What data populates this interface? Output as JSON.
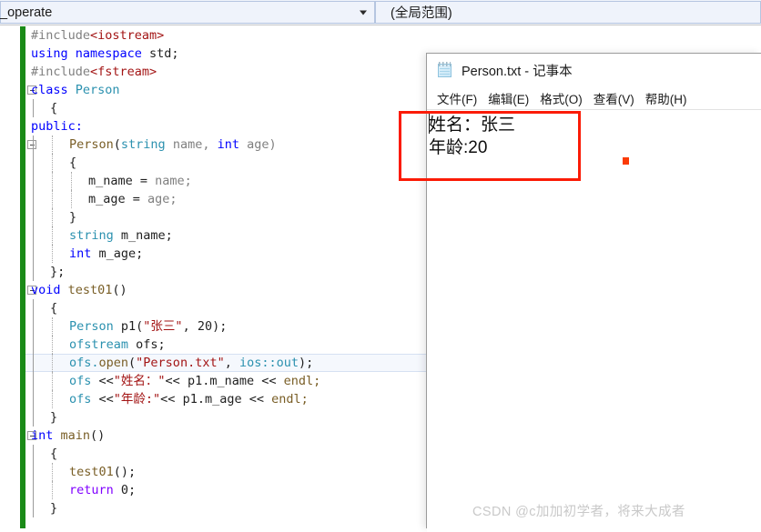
{
  "ide": {
    "navbar": {
      "scope_combo_value": "t_operate",
      "scope_combo_arrow": "chevron-down-icon",
      "member_combo_value": "(全局范围)"
    },
    "code": {
      "language": "cpp",
      "current_line_index": 18,
      "lines": [
        {
          "indent": 0,
          "tokens": [
            {
              "t": "#include",
              "c": "t-pre"
            },
            {
              "t": "<iostream>",
              "c": "t-str2"
            }
          ]
        },
        {
          "indent": 0,
          "tokens": [
            {
              "t": "using namespace ",
              "c": "t-kw"
            },
            {
              "t": "std;",
              "c": "t-id"
            }
          ]
        },
        {
          "indent": 0,
          "tokens": [
            {
              "t": "#include",
              "c": "t-pre"
            },
            {
              "t": "<fstream>",
              "c": "t-str2"
            }
          ]
        },
        {
          "indent": 0,
          "tokens": [
            {
              "t": "class ",
              "c": "t-kw"
            },
            {
              "t": "Person",
              "c": "t-type"
            }
          ]
        },
        {
          "indent": 1,
          "tokens": [
            {
              "t": "{",
              "c": "t-punct"
            }
          ]
        },
        {
          "indent": 0,
          "tokens": [
            {
              "t": "public:",
              "c": "t-kw"
            }
          ]
        },
        {
          "indent": 2,
          "tokens": [
            {
              "t": "Person",
              "c": "t-fn"
            },
            {
              "t": "(",
              "c": "t-punct"
            },
            {
              "t": "string",
              "c": "t-type"
            },
            {
              "t": " name, ",
              "c": "t-var"
            },
            {
              "t": "int",
              "c": "t-kw"
            },
            {
              "t": " age)",
              "c": "t-var"
            }
          ]
        },
        {
          "indent": 2,
          "tokens": [
            {
              "t": "{",
              "c": "t-punct"
            }
          ]
        },
        {
          "indent": 3,
          "tokens": [
            {
              "t": "m_name ",
              "c": "t-id"
            },
            {
              "t": "= ",
              "c": "t-punct"
            },
            {
              "t": "name;",
              "c": "t-var"
            }
          ]
        },
        {
          "indent": 3,
          "tokens": [
            {
              "t": "m_age ",
              "c": "t-id"
            },
            {
              "t": "= ",
              "c": "t-punct"
            },
            {
              "t": "age;",
              "c": "t-var"
            }
          ]
        },
        {
          "indent": 2,
          "tokens": [
            {
              "t": "}",
              "c": "t-punct"
            }
          ]
        },
        {
          "indent": 2,
          "tokens": [
            {
              "t": "string",
              "c": "t-type"
            },
            {
              "t": " m_name;",
              "c": "t-id"
            }
          ]
        },
        {
          "indent": 2,
          "tokens": [
            {
              "t": "int",
              "c": "t-kw"
            },
            {
              "t": " m_age;",
              "c": "t-id"
            }
          ]
        },
        {
          "indent": 1,
          "tokens": [
            {
              "t": "};",
              "c": "t-punct"
            }
          ]
        },
        {
          "indent": 0,
          "tokens": [
            {
              "t": "void ",
              "c": "t-kw"
            },
            {
              "t": "test01",
              "c": "t-fn"
            },
            {
              "t": "()",
              "c": "t-punct"
            }
          ]
        },
        {
          "indent": 1,
          "tokens": [
            {
              "t": "{",
              "c": "t-punct"
            }
          ]
        },
        {
          "indent": 2,
          "tokens": [
            {
              "t": "Person",
              "c": "t-type"
            },
            {
              "t": " p1(",
              "c": "t-id"
            },
            {
              "t": "\"张三\"",
              "c": "t-str"
            },
            {
              "t": ", ",
              "c": "t-punct"
            },
            {
              "t": "20",
              "c": "t-num"
            },
            {
              "t": ");",
              "c": "t-punct"
            }
          ]
        },
        {
          "indent": 2,
          "tokens": [
            {
              "t": "ofstream",
              "c": "t-type"
            },
            {
              "t": " ofs;",
              "c": "t-id"
            }
          ]
        },
        {
          "indent": 2,
          "tokens": [
            {
              "t": "ofs.",
              "c": "t-type"
            },
            {
              "t": "open",
              "c": "t-fn"
            },
            {
              "t": "(",
              "c": "t-punct"
            },
            {
              "t": "\"Person.txt\"",
              "c": "t-str"
            },
            {
              "t": ", ",
              "c": "t-punct"
            },
            {
              "t": "ios::out",
              "c": "t-type"
            },
            {
              "t": ");",
              "c": "t-punct"
            }
          ]
        },
        {
          "indent": 2,
          "tokens": [
            {
              "t": "ofs ",
              "c": "t-type"
            },
            {
              "t": "<<",
              "c": "t-punct"
            },
            {
              "t": "\"姓名：\"",
              "c": "t-str"
            },
            {
              "t": "<< ",
              "c": "t-punct"
            },
            {
              "t": "p1.m_name ",
              "c": "t-id"
            },
            {
              "t": "<< ",
              "c": "t-punct"
            },
            {
              "t": "endl;",
              "c": "t-fn"
            }
          ]
        },
        {
          "indent": 2,
          "tokens": [
            {
              "t": "ofs ",
              "c": "t-type"
            },
            {
              "t": "<<",
              "c": "t-punct"
            },
            {
              "t": "\"年龄:\"",
              "c": "t-str"
            },
            {
              "t": "<< ",
              "c": "t-punct"
            },
            {
              "t": "p1.m_age ",
              "c": "t-id"
            },
            {
              "t": "<< ",
              "c": "t-punct"
            },
            {
              "t": "endl;",
              "c": "t-fn"
            }
          ]
        },
        {
          "indent": 1,
          "tokens": [
            {
              "t": "}",
              "c": "t-punct"
            }
          ]
        },
        {
          "indent": 0,
          "tokens": [
            {
              "t": "int ",
              "c": "t-kw"
            },
            {
              "t": "main",
              "c": "t-fn"
            },
            {
              "t": "()",
              "c": "t-punct"
            }
          ]
        },
        {
          "indent": 1,
          "tokens": [
            {
              "t": "{",
              "c": "t-punct"
            }
          ]
        },
        {
          "indent": 2,
          "tokens": [
            {
              "t": "test01",
              "c": "t-fn"
            },
            {
              "t": "();",
              "c": "t-punct"
            }
          ]
        },
        {
          "indent": 2,
          "tokens": [
            {
              "t": "return ",
              "c": "t-kw2"
            },
            {
              "t": "0;",
              "c": "t-num"
            }
          ]
        },
        {
          "indent": 1,
          "tokens": [
            {
              "t": "}",
              "c": "t-punct"
            }
          ]
        }
      ],
      "collapse_line_indices": [
        3,
        6,
        14,
        22
      ]
    }
  },
  "notepad": {
    "icon": "notepad-icon",
    "title": "Person.txt - 记事本",
    "menu": [
      {
        "label": "文件(F)"
      },
      {
        "label": "编辑(E)"
      },
      {
        "label": "格式(O)"
      },
      {
        "label": "查看(V)"
      },
      {
        "label": "帮助(H)"
      }
    ],
    "content_lines": [
      "姓名：张三",
      "年龄:20"
    ]
  },
  "annotations": {
    "highlight_rect_color": "#fb1b06",
    "dot_color": "#fb3b06"
  },
  "watermark": {
    "text": "CSDN @c加加初学者，将来大成者"
  }
}
